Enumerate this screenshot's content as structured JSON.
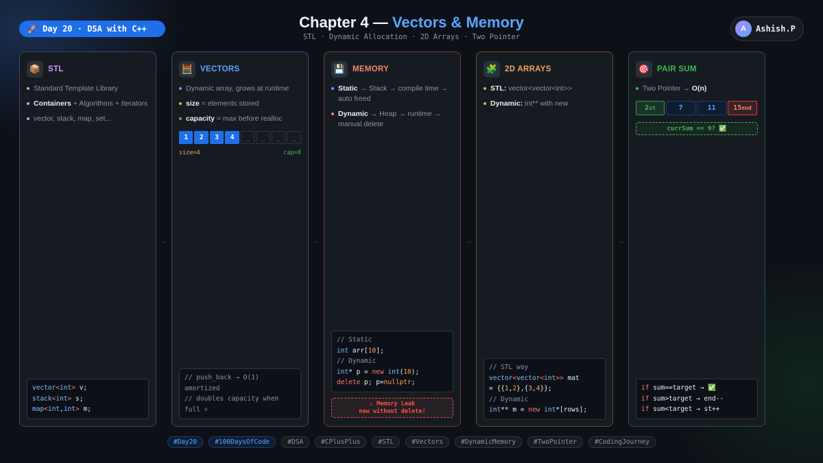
{
  "header": {
    "day_badge": "🚀 Day 20 · DSA with C++",
    "title_prefix": "Chapter 4 —",
    "title_accent": "Vectors & Memory",
    "subtitle": "STL · Dynamic Allocation · 2D Arrays · Two Pointer",
    "user": {
      "initial": "A",
      "name": "Ashish.P"
    }
  },
  "colors": {
    "stl": "#c39bff",
    "vectors": "#58a6ff",
    "memory": "#f0866b",
    "arrays": "#f0a35a",
    "pairsum": "#3fb950"
  },
  "arrow": "→",
  "cards": {
    "stl": {
      "icon": "📦",
      "title": "STL",
      "bullets": [
        {
          "strong": "",
          "text": "Standard Template Library"
        },
        {
          "strong": "Containers",
          "text": " + Algorithms + Iterators"
        },
        {
          "strong": "",
          "text": "vector, stack, map, set..."
        }
      ],
      "code": [
        "vector<int> v;",
        "stack<int> s;",
        "map<int,int> m;"
      ]
    },
    "vectors": {
      "icon": "🧮",
      "title": "VECTORS",
      "bullets": [
        {
          "strong": "",
          "text": "Dynamic array, grows at runtime"
        },
        {
          "strong": "size",
          "text": " = elements stored"
        },
        {
          "strong": "capacity",
          "text": " = max before realloc"
        }
      ],
      "cells": [
        "1",
        "2",
        "3",
        "4",
        "_",
        "_",
        "_",
        "_"
      ],
      "size_label": "size=4",
      "cap_label": "cap=8",
      "code": [
        "// push_back → O(1)",
        "amortized",
        "// doubles capacity when",
        "full ⚡"
      ]
    },
    "memory": {
      "icon": "💾",
      "title": "MEMORY",
      "bullets": [
        {
          "strong": "Static",
          "text": " → Stack → compile time → auto freed"
        },
        {
          "strong": "Dynamic",
          "text": " → Heap → runtime → manual delete"
        }
      ],
      "code": [
        "// Static",
        "int arr[10];",
        "// Dynamic",
        "int* p = new int(10);",
        "delete p; p=nullptr;"
      ],
      "leak_line1": "⚠ Memory Leak",
      "leak_line2": "new without delete!"
    },
    "arrays": {
      "icon": "🧩",
      "title": "2D ARRAYS",
      "bullets": [
        {
          "strong": "STL:",
          "text": " vector<vector<int>>"
        },
        {
          "strong": "Dynamic:",
          "text": " int** with new"
        }
      ],
      "code": [
        "// STL way",
        "vector<vector<int>> mat",
        "= {{1,2},{3,4}};",
        "// Dynamic",
        "int** m = new int*[rows];"
      ]
    },
    "pairsum": {
      "icon": "🎯",
      "title": "PAIR SUM",
      "bullets": [
        {
          "strong": "",
          "text": "Two Pointer → ",
          "strong2": "O(n)"
        }
      ],
      "cells": [
        {
          "value": "2",
          "tag": "st"
        },
        {
          "value": "7",
          "tag": ""
        },
        {
          "value": "11",
          "tag": ""
        },
        {
          "value": "15",
          "tag": "end"
        }
      ],
      "check": "currSum == 9? ✅",
      "code": [
        "if sum==target → ✅",
        "if sum>target → end--",
        "if sum<target → st++"
      ]
    }
  },
  "tags": [
    "#Day20",
    "#100DaysOfCode",
    "#DSA",
    "#CPlusPlus",
    "#STL",
    "#Vectors",
    "#DynamicMemory",
    "#TwoPointer",
    "#CodingJourney"
  ]
}
